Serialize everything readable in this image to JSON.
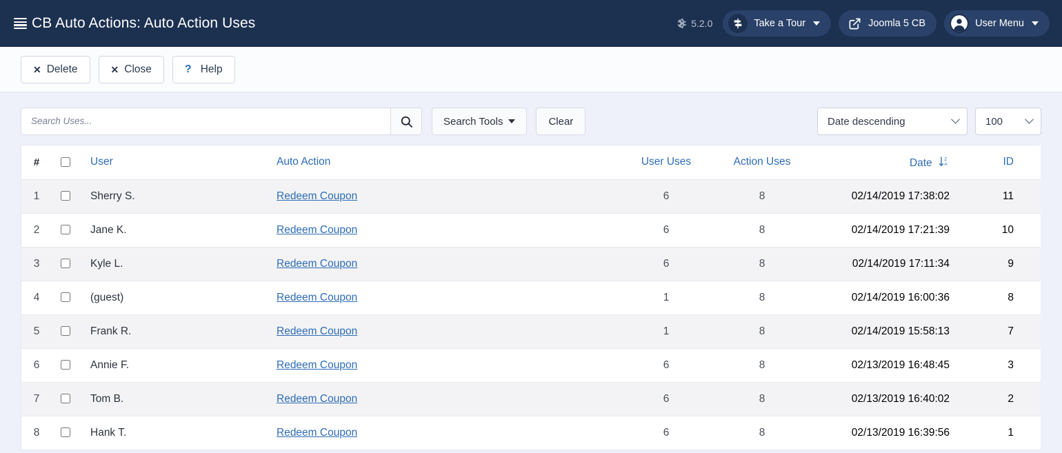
{
  "header": {
    "title": "CB Auto Actions: Auto Action Uses",
    "menu_icon": "hamburger-icon",
    "version": "5.2.0",
    "version_icon": "joomla-logo-icon",
    "buttons": [
      {
        "label": "Take a Tour",
        "icon": "signpost-icon",
        "caret": true
      },
      {
        "label": "Joomla 5 CB",
        "icon": "external-link-icon",
        "caret": false
      },
      {
        "label": "User Menu",
        "icon": "user-circle-icon",
        "caret": true
      }
    ]
  },
  "toolbar": {
    "delete_label": "Delete",
    "close_label": "Close",
    "help_label": "Help",
    "delete_icon": "close-x-icon",
    "close_icon": "close-x-icon",
    "help_icon": "question-mark-icon"
  },
  "filters": {
    "search_placeholder": "Search Uses...",
    "search_value": "",
    "search_icon": "search-icon",
    "search_tools_label": "Search Tools",
    "clear_label": "Clear",
    "sort_value": "Date descending",
    "sort_options": [
      "Date descending"
    ],
    "limit_value": "100",
    "limit_options": [
      "100"
    ]
  },
  "table": {
    "columns": {
      "hash": "#",
      "user": "User",
      "action": "Auto Action",
      "user_uses": "User Uses",
      "action_uses": "Action Uses",
      "date": "Date",
      "id": "ID"
    },
    "sort_icon": "sort-descending-za-icon",
    "select_all_checkbox": false,
    "rows": [
      {
        "num": "1",
        "user": "Sherry S.",
        "action": "Redeem Coupon",
        "user_uses": "6",
        "action_uses": "8",
        "date": "02/14/2019 17:38:02",
        "id": "11"
      },
      {
        "num": "2",
        "user": "Jane K.",
        "action": "Redeem Coupon",
        "user_uses": "6",
        "action_uses": "8",
        "date": "02/14/2019 17:21:39",
        "id": "10"
      },
      {
        "num": "3",
        "user": "Kyle L.",
        "action": "Redeem Coupon",
        "user_uses": "6",
        "action_uses": "8",
        "date": "02/14/2019 17:11:34",
        "id": "9"
      },
      {
        "num": "4",
        "user": "(guest)",
        "action": "Redeem Coupon",
        "user_uses": "1",
        "action_uses": "8",
        "date": "02/14/2019 16:00:36",
        "id": "8"
      },
      {
        "num": "5",
        "user": "Frank R.",
        "action": "Redeem Coupon",
        "user_uses": "1",
        "action_uses": "8",
        "date": "02/14/2019 15:58:13",
        "id": "7"
      },
      {
        "num": "6",
        "user": "Annie F.",
        "action": "Redeem Coupon",
        "user_uses": "6",
        "action_uses": "8",
        "date": "02/13/2019 16:48:45",
        "id": "3"
      },
      {
        "num": "7",
        "user": "Tom B.",
        "action": "Redeem Coupon",
        "user_uses": "6",
        "action_uses": "8",
        "date": "02/13/2019 16:40:02",
        "id": "2"
      },
      {
        "num": "8",
        "user": "Hank T.",
        "action": "Redeem Coupon",
        "user_uses": "6",
        "action_uses": "8",
        "date": "02/13/2019 16:39:56",
        "id": "1"
      }
    ]
  },
  "colors": {
    "header_bg": "#1c3050",
    "pill_bg": "#2a4269",
    "link": "#2d6cb5",
    "page_bg": "#eef0fa",
    "row_odd": "#f3f3f5"
  }
}
